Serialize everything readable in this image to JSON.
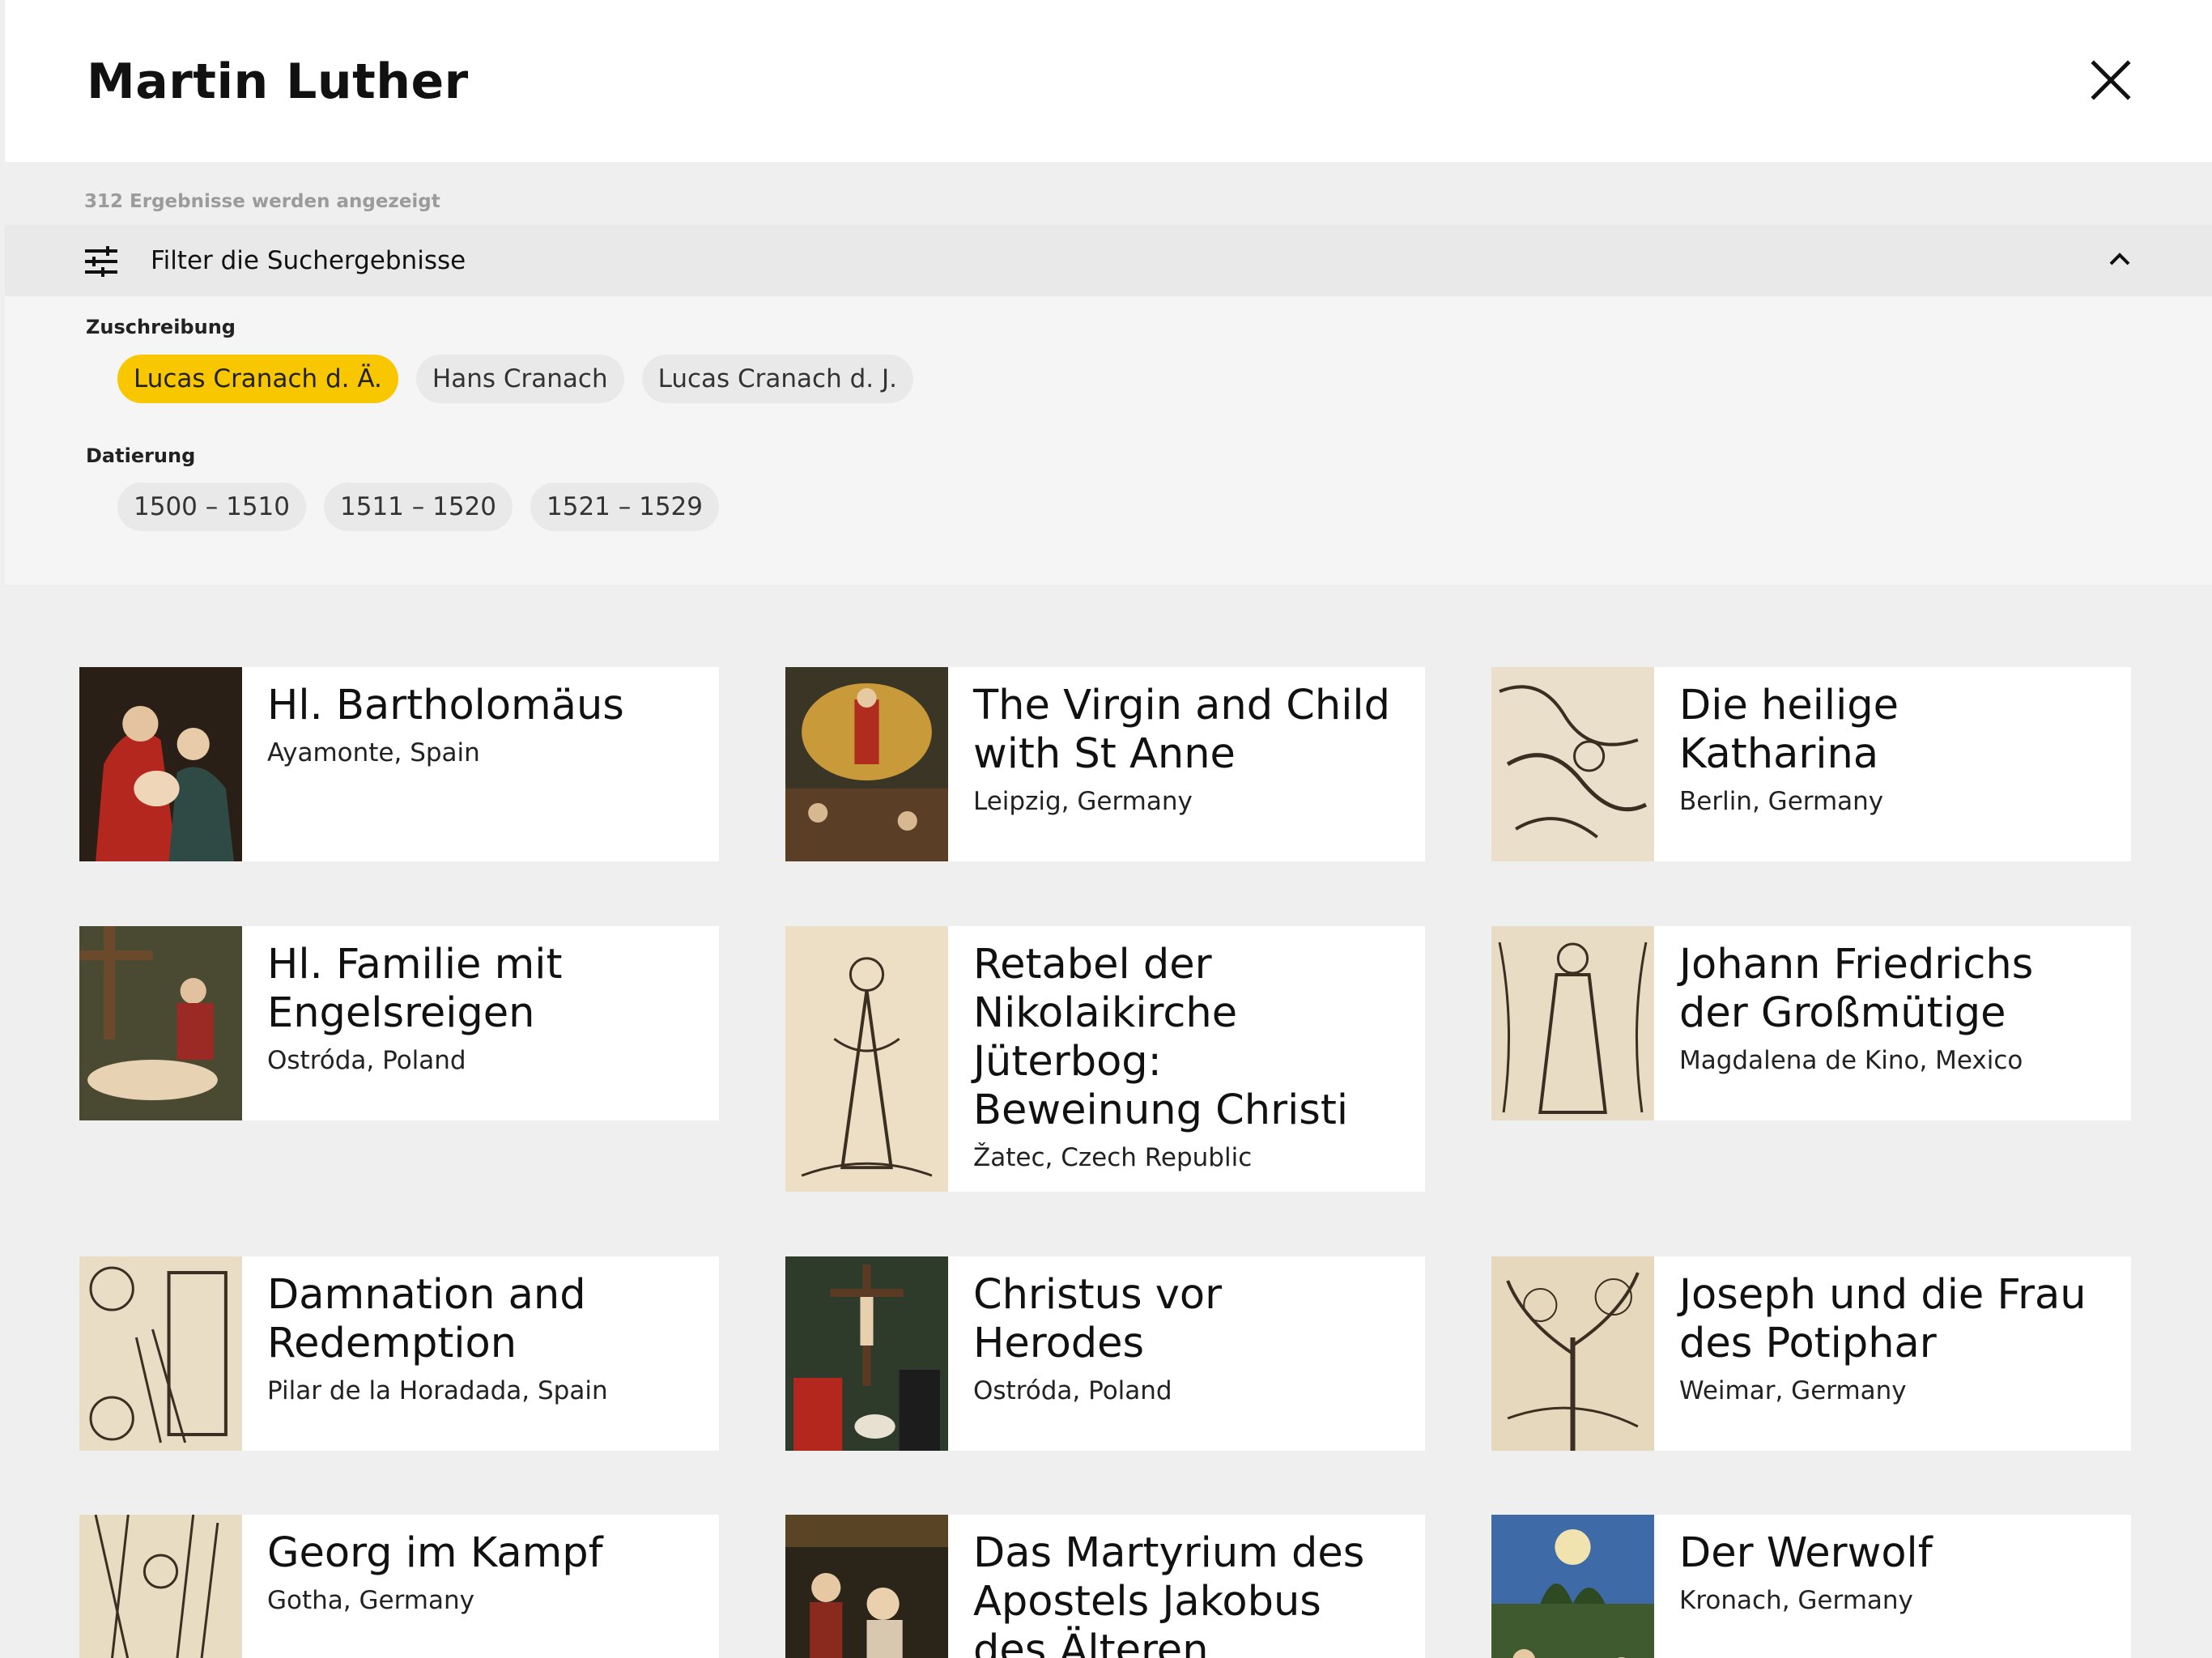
{
  "header": {
    "title": "Martin Luther",
    "close_icon": "close-icon"
  },
  "results": {
    "text": "312 Ergebnisse werden angezeigt"
  },
  "filter": {
    "label": "Filter die Suchergebnisse",
    "icon": "sliders-icon",
    "toggle_icon": "chevron-up-icon",
    "groups": [
      {
        "label": "Zuschreibung",
        "chips": [
          "Lucas Cranach d. Ä.",
          "Hans Cranach",
          "Lucas Cranach d. J."
        ],
        "active": 0
      },
      {
        "label": "Datierung",
        "chips": [
          "1500 – 1510",
          "1511 – 1520",
          "1521 – 1529"
        ],
        "active": -1
      }
    ]
  },
  "colors": {
    "accent": "#f8c700",
    "background": "#efefef",
    "card": "#ffffff"
  },
  "cards": [
    {
      "title": "Hl. Bartholomäus",
      "location": "Ayamonte, Spain",
      "thumb": "painting"
    },
    {
      "title": "The Virgin and Child with St Anne",
      "location": "Leipzig, Germany",
      "thumb": "painting"
    },
    {
      "title": "Die heilige Katharina",
      "location": "Berlin, Germany",
      "thumb": "woodcut"
    },
    {
      "title": "Hl. Familie mit Engelsreigen",
      "location": "Ostróda, Poland",
      "thumb": "painting"
    },
    {
      "title": "Retabel der Nikolaikirche Jüterbog: Beweinung Christi",
      "location": "Žatec, Czech Republic",
      "thumb": "woodcut"
    },
    {
      "title": "Johann Friedrichs der Großmütige",
      "location": "Magdalena de Kino, Mexico",
      "thumb": "woodcut"
    },
    {
      "title": "Damnation and Redemption",
      "location": "Pilar de la Horadada, Spain",
      "thumb": "woodcut"
    },
    {
      "title": "Christus vor Herodes",
      "location": "Ostróda, Poland",
      "thumb": "painting"
    },
    {
      "title": "Joseph und die Frau des Potiphar",
      "location": "Weimar, Germany",
      "thumb": "woodcut"
    },
    {
      "title": "Georg im Kampf",
      "location": "Gotha, Germany",
      "thumb": "woodcut"
    },
    {
      "title": "Das Martyrium des Apostels Jakobus des Älteren",
      "location": "",
      "thumb": "painting"
    },
    {
      "title": "Der Werwolf",
      "location": "Kronach, Germany",
      "thumb": "painting"
    }
  ]
}
